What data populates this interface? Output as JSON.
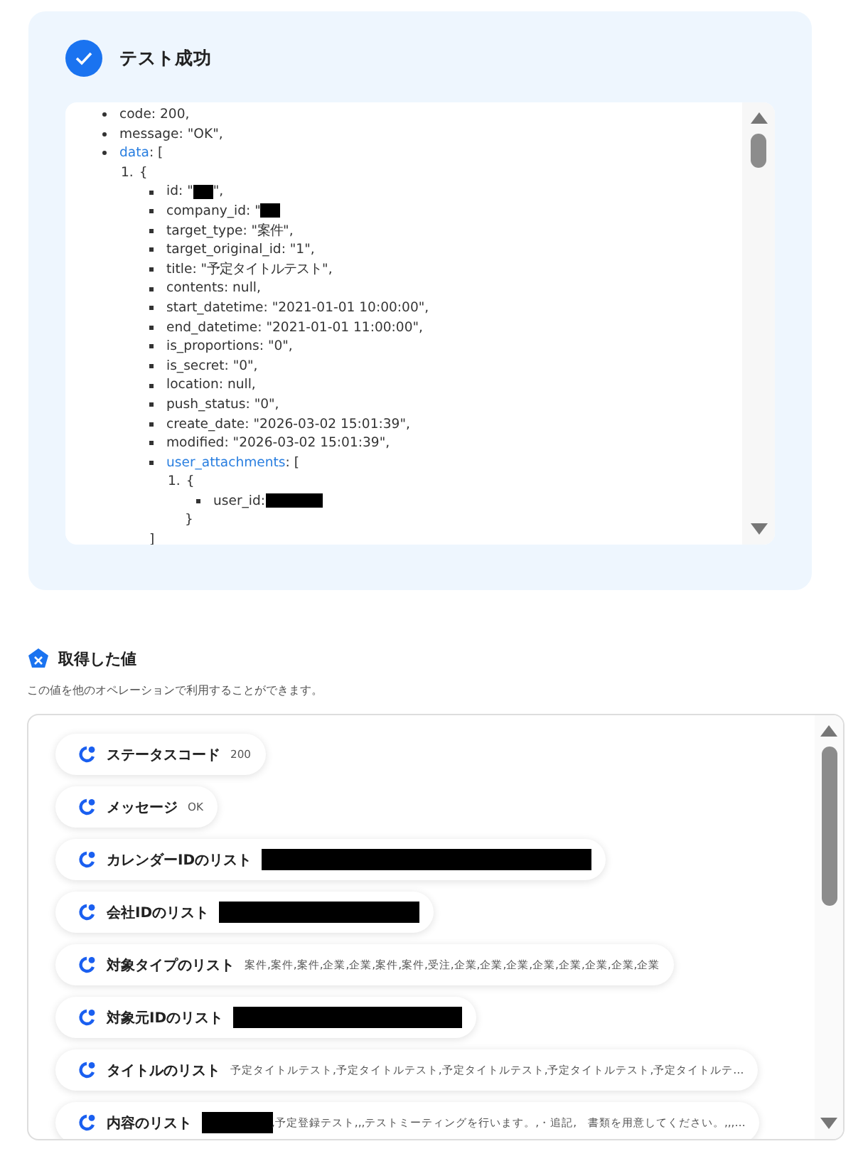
{
  "result": {
    "title": "テスト成功",
    "success": true,
    "tree": [
      {
        "key": "code",
        "value": ": 200,"
      },
      {
        "key": "message",
        "value": ": \"OK\","
      },
      {
        "key": "data",
        "link": true,
        "value": ": [",
        "children": [
          {
            "marker": "1.",
            "value": "{",
            "children": [
              {
                "key": "id",
                "value": ": \"",
                "redacted": true,
                "after": "\","
              },
              {
                "key": "company_id",
                "value": ": \"",
                "redacted": true
              },
              {
                "key": "target_type",
                "value": ": \"案件\","
              },
              {
                "key": "target_original_id",
                "value": ": \"1\","
              },
              {
                "key": "title",
                "value": ": \"予定タイトルテスト\","
              },
              {
                "key": "contents",
                "value": ": null,"
              },
              {
                "key": "start_datetime",
                "value": ": \"2021-01-01 10:00:00\","
              },
              {
                "key": "end_datetime",
                "value": ": \"2021-01-01 11:00:00\","
              },
              {
                "key": "is_proportions",
                "value": ": \"0\","
              },
              {
                "key": "is_secret",
                "value": ": \"0\","
              },
              {
                "key": "location",
                "value": ": null,"
              },
              {
                "key": "push_status",
                "value": ": \"0\","
              },
              {
                "key": "create_date",
                "value": ": \"2026-03-02 15:01:39\","
              },
              {
                "key": "modified",
                "value": ": \"2026-03-02 15:01:39\","
              },
              {
                "key": "user_attachments",
                "link": true,
                "value": ": [",
                "close": "]",
                "children": [
                  {
                    "marker": "1.",
                    "value": "{",
                    "close": "}",
                    "children": [
                      {
                        "key": "user_id",
                        "value": ":",
                        "redacted": true
                      }
                    ]
                  }
                ]
              }
            ]
          }
        ]
      }
    ]
  },
  "values": {
    "title": "取得した値",
    "subtitle": "この値を他のオペレーションで利用することができます。",
    "items": [
      {
        "label": "ステータスコード",
        "value": "200"
      },
      {
        "label": "メッセージ",
        "value": "OK"
      },
      {
        "label": "カレンダーIDのリスト",
        "redacted": true
      },
      {
        "label": "会社IDのリスト",
        "redacted": true
      },
      {
        "label": "対象タイプのリスト",
        "value": "案件,案件,案件,企業,企業,案件,案件,受注,企業,企業,企業,企業,企業,企業,企業,企業"
      },
      {
        "label": "対象元IDのリスト",
        "redacted": true
      },
      {
        "label": "タイトルのリスト",
        "value": "予定タイトルテスト,予定タイトルテスト,予定タイトルテスト,予定タイトルテスト,予定タイトルテ…"
      },
      {
        "label": "内容のリスト",
        "redacted": true,
        "value": ",予定登録テスト,,,テストミーティングを行います。,・追記,　書類を用意してください。,,,…"
      }
    ]
  }
}
